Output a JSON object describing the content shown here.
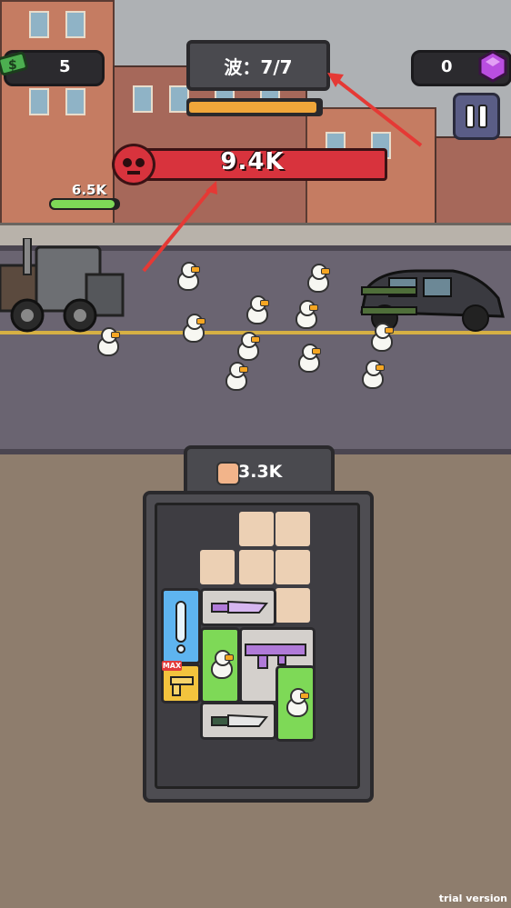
{
  "hud": {
    "cash": "5",
    "gems": "0",
    "wave_label": "波：7/7",
    "wave_progress": 0.97,
    "boss_hp": "9.4K",
    "player_hp": "6.5K",
    "player_hp_fraction": 0.95
  },
  "panel": {
    "power": "3.3K"
  },
  "watermark": "trial version",
  "colors": {
    "accent_red": "#e53935",
    "boss_bar": "#d8333d",
    "hp_green": "#7ed957",
    "wave_orange": "#f0a63a",
    "gem_purple": "#b94ee0",
    "cash_green": "#4caf50"
  },
  "icons": {
    "cash": "cash-icon",
    "gem": "gem-icon",
    "pause": "pause-icon",
    "boss": "demon-skull-icon",
    "power": "fist-icon"
  }
}
